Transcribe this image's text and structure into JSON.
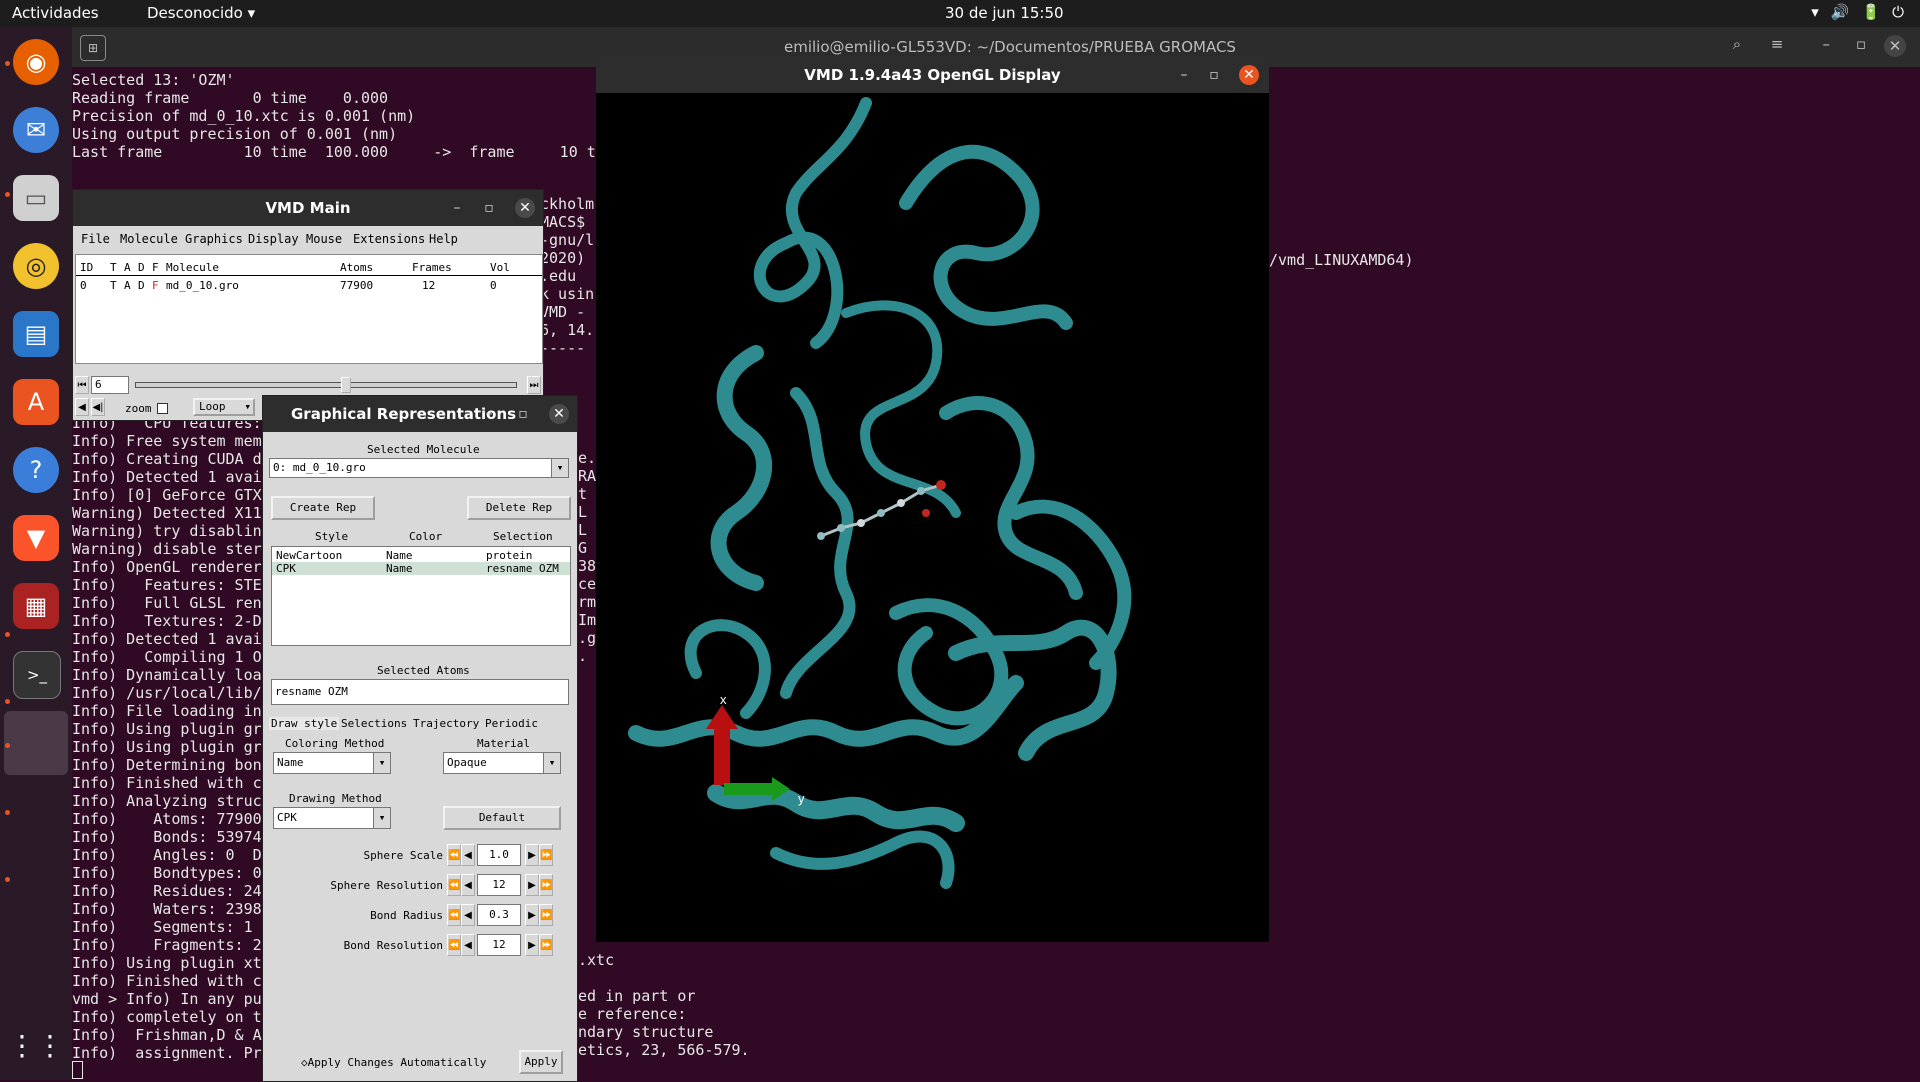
{
  "topbar": {
    "activities": "Actividades",
    "network": "Desconocido ▾",
    "clock": "30 de jun  15:50",
    "tray": [
      "▾",
      "🔊",
      "🔋",
      "⏻"
    ]
  },
  "terminal": {
    "title": "emilio@emilio-GL553VD: ~/Documentos/PRUEBA GROMACS",
    "lines_top": [
      "Selected 13: 'OZM'",
      "Reading frame       0 time    0.000",
      "Precision of md_0_10.xtc is 0.001 (nm)",
      "Using output precision of 0.001 (nm)",
      "Last frame         10 time  100.000     ->  frame     10 ti"
    ],
    "lines_left": [
      "Info)   CPU features:",
      "Info) Free system mem",
      "Info) Creating CUDA d",
      "Info) Detected 1 avai",
      "Info) [0] GeForce GTX",
      "Warning) Detected X11",
      "Warning) try disablin",
      "Warning) disable ster",
      "Info) OpenGL renderer",
      "Info)   Features: STE",
      "Info)   Full GLSL ren",
      "Info)   Textures: 2-D",
      "Info) Detected 1 avai",
      "Info)   Compiling 1 O",
      "Info) Dynamically loa",
      "Info) /usr/local/lib/",
      "Info) File loading in",
      "Info) Using plugin gr",
      "Info) Using plugin gr",
      "Info) Determining bon",
      "Info) Finished with c",
      "Info) Analyzing struc",
      "Info)    Atoms: 77900",
      "Info)    Bonds: 53974",
      "Info)    Angles: 0  D",
      "Info)    Bondtypes: 0",
      "Info)    Residues: 24",
      "Info)    Waters: 2398",
      "Info)    Segments: 1",
      "Info)    Fragments: 2",
      "Info) Using plugin xt",
      "Info) Finished with c",
      "vmd > Info) In any pu",
      "Info) completely on t",
      "Info)  Frishman,D & A",
      "Info)  assignment. Pr"
    ],
    "mid_fragments": [
      {
        "text": "ckholm",
        "row": 0
      },
      {
        "text": "MACS$",
        "row": 1
      },
      {
        "text": "-gnu/l",
        "row": 2
      },
      {
        "text": "2020)",
        "row": 3
      },
      {
        "text": ".edu",
        "row": 4
      },
      {
        "text": "k usin",
        "row": 5
      },
      {
        "text": "VMD -",
        "row": 6
      },
      {
        "text": "6, 14.",
        "row": 7
      },
      {
        "text": "-----",
        "row": 8
      }
    ],
    "right_fragment": "/vmd_LINUXAMD64)",
    "bottom_fragments": [
      ".xtc",
      "",
      "ed in part or",
      "e reference:",
      "ndary structure",
      "etics, 23, 566-579."
    ],
    "side_fragments": [
      "e.",
      "RA",
      "t",
      "L",
      "L",
      "G",
      "38",
      "ce",
      "rm",
      "Im",
      ".g",
      "."
    ]
  },
  "vmd_main": {
    "title": "VMD Main",
    "menu": [
      "File",
      "Molecule",
      "Graphics",
      "Display",
      "Mouse",
      "Extensions",
      "Help"
    ],
    "columns": [
      "ID",
      "T",
      "A",
      "D",
      "F",
      "Molecule",
      "Atoms",
      "Frames",
      "Vol"
    ],
    "row": {
      "id": "0",
      "t": "T",
      "a": "A",
      "d": "D",
      "f": "F",
      "molecule": "md_0_10.gro",
      "atoms": "77900",
      "frames": "12",
      "vol": "0"
    },
    "frame_value": "6",
    "zoom_label": "zoom",
    "loop_label": "Loop"
  },
  "reps": {
    "title": "Graphical Representations",
    "selected_molecule_label": "Selected Molecule",
    "selected_molecule": "0: md_0_10.gro",
    "create_rep": "Create Rep",
    "delete_rep": "Delete Rep",
    "headers": [
      "Style",
      "Color",
      "Selection"
    ],
    "rows": [
      {
        "style": "NewCartoon",
        "color": "Name",
        "selection": "protein"
      },
      {
        "style": "CPK",
        "color": "Name",
        "selection": "resname OZM"
      }
    ],
    "selected_atoms_label": "Selected Atoms",
    "selected_atoms": "resname OZM",
    "tabs": [
      "Draw style",
      "Selections",
      "Trajectory",
      "Periodic"
    ],
    "coloring_method_label": "Coloring Method",
    "coloring_method": "Name",
    "material_label": "Material",
    "material": "Opaque",
    "drawing_method_label": "Drawing Method",
    "drawing_method": "CPK",
    "default_btn": "Default",
    "params": [
      {
        "label": "Sphere Scale",
        "value": "1.0"
      },
      {
        "label": "Sphere Resolution",
        "value": "12"
      },
      {
        "label": "Bond Radius",
        "value": "0.3"
      },
      {
        "label": "Bond Resolution",
        "value": "12"
      }
    ],
    "apply_auto": "Apply Changes Automatically",
    "apply": "Apply"
  },
  "gl": {
    "title": "VMD 1.9.4a43 OpenGL Display",
    "axis_x": "x",
    "axis_y": "y"
  },
  "colors": {
    "terminal_bg": "#300a24",
    "accent": "#e95420",
    "protein": "#2e8b8f"
  }
}
